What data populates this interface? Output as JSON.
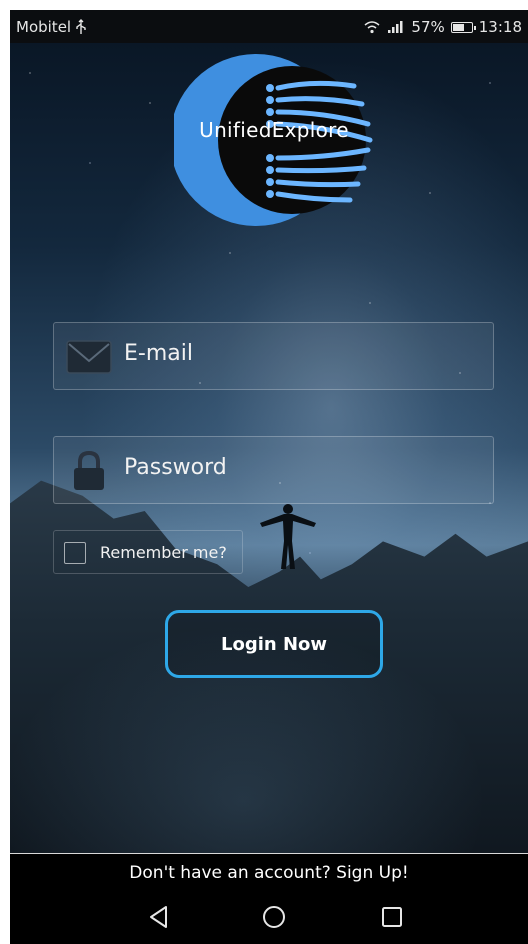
{
  "status_bar": {
    "carrier": "Mobitel",
    "usb_icon": "usb-icon",
    "battery_percent": "57%",
    "time": "13:18"
  },
  "logo": {
    "text": "UnifiedExplore",
    "colors": {
      "crescent": "#3f8fe0",
      "disc": "#0a0a0a",
      "lines": "#6cb6ff"
    }
  },
  "form": {
    "email_placeholder": "E-mail",
    "password_placeholder": "Password",
    "remember_label": "Remember me?",
    "remember_checked": false,
    "login_label": "Login Now"
  },
  "footer": {
    "signup_text": "Don't have an account? Sign Up!"
  },
  "nav": {
    "back_icon": "back-triangle-icon",
    "home_icon": "home-circle-icon",
    "recent_icon": "recent-square-icon"
  },
  "colors": {
    "accent": "#2ea8e8"
  }
}
